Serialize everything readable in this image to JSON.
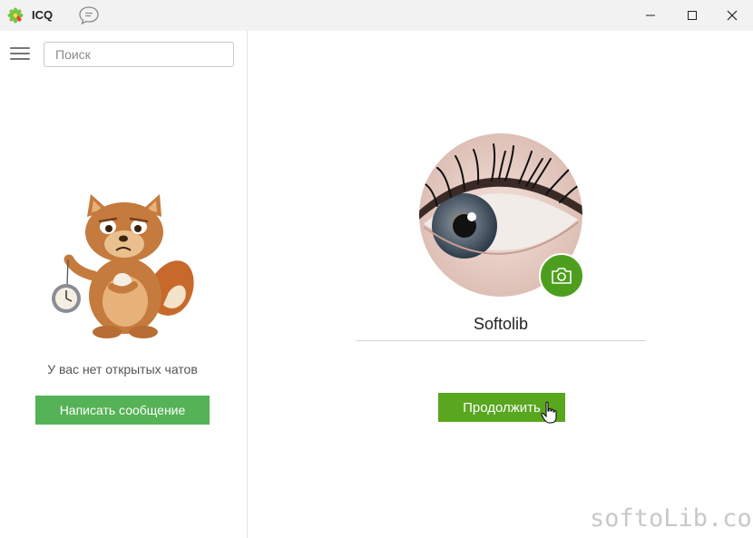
{
  "titlebar": {
    "app_title": "ICQ",
    "logo_icon": "icq-flower-icon",
    "chat_icon": "chat-bubble-icon",
    "buttons": [
      "minimize-icon",
      "maximize-icon",
      "close-icon"
    ]
  },
  "sidebar": {
    "search_placeholder": "Поиск",
    "empty_text": "У вас нет открытых чатов",
    "write_button": "Написать сообщение"
  },
  "main": {
    "user_name": "Softolib",
    "continue_button": "Продолжить"
  },
  "watermark": "softoLib.com",
  "colors": {
    "accent_green": "#59a61f",
    "sidebar_button_green": "#55b256",
    "titlebar_bg": "#f2f2f2"
  }
}
